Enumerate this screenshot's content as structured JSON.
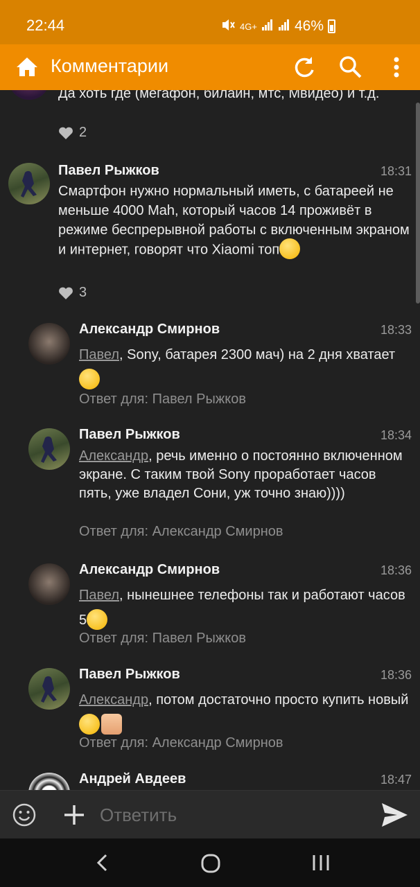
{
  "status_bar": {
    "time": "22:44",
    "network": "4G+",
    "battery_percent": "46%",
    "icons": [
      "mute-icon",
      "signal-icon",
      "signal-icon",
      "battery-icon"
    ]
  },
  "app_bar": {
    "title": "Комментарии",
    "icons": [
      "home-icon",
      "refresh-icon",
      "search-icon",
      "more-vert-icon"
    ]
  },
  "comments": [
    {
      "text": "Да хоть где (мегафон, билайн, мтс, Мвидео) и т.д.",
      "likes": "2"
    },
    {
      "author": "Павел Рыжков",
      "time": "18:31",
      "text": "Смартфон нужно нормальный иметь, с батареей не меньше 4000 Mah, который часов 14 проживёт в режиме беспрерывной работы с включенным экраном и интернет, говорят что Xiaomi топ",
      "emoji": "wink-emoji",
      "likes": "3"
    },
    {
      "author": "Александр Смирнов",
      "time": "18:33",
      "mention": "Павел",
      "text": ", Sony, батарея 2300 мач) на 2 дня хватает",
      "emoji": "grin-emoji",
      "reply_to": "Ответ для: Павел Рыжков"
    },
    {
      "author": "Павел Рыжков",
      "time": "18:34",
      "mention": "Александр",
      "text": ", речь именно о постоянно включенном экране. С таким твой Sony проработает часов пять, уже владел Сони, уж точно знаю))))",
      "reply_to": "Ответ для: Александр Смирнов"
    },
    {
      "author": "Александр Смирнов",
      "time": "18:36",
      "mention": "Павел",
      "text": ", нынешнее телефоны так и работают часов 5",
      "emoji": "rofl-emoji",
      "reply_to": "Ответ для: Павел Рыжков"
    },
    {
      "author": "Павел Рыжков",
      "time": "18:36",
      "mention": "Александр",
      "text": ", потом достаточно просто купить новый ",
      "emoji": "smirk-thumbsup-emoji",
      "reply_to": "Ответ для: Александр Смирнов"
    },
    {
      "author": "Андрей Авдеев",
      "time": "18:47"
    }
  ],
  "composer": {
    "placeholder": "Ответить",
    "icons": [
      "emoji-icon",
      "plus-icon",
      "send-icon"
    ]
  },
  "nav_bar": {
    "icons": [
      "back-icon",
      "home-circle-icon",
      "recents-icon"
    ]
  },
  "colors": {
    "accent": "#f08c00",
    "status_bar": "#d98200",
    "background": "#212121"
  }
}
